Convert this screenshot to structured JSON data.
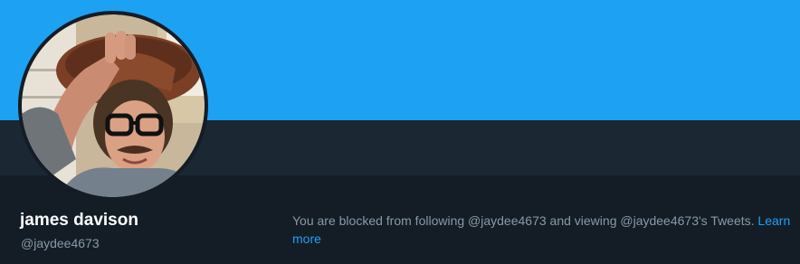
{
  "profile": {
    "display_name": "james davison",
    "handle": "@jaydee4673"
  },
  "blocked_notice": {
    "message": "You are blocked from following @jaydee4673 and viewing @jaydee4673's Tweets.",
    "learn_more_label": "Learn more"
  },
  "colors": {
    "banner": "#1da1f2",
    "nav_strip": "#1b2733",
    "background": "#141d26",
    "link": "#1da1f2",
    "secondary_text": "#8899a6"
  }
}
